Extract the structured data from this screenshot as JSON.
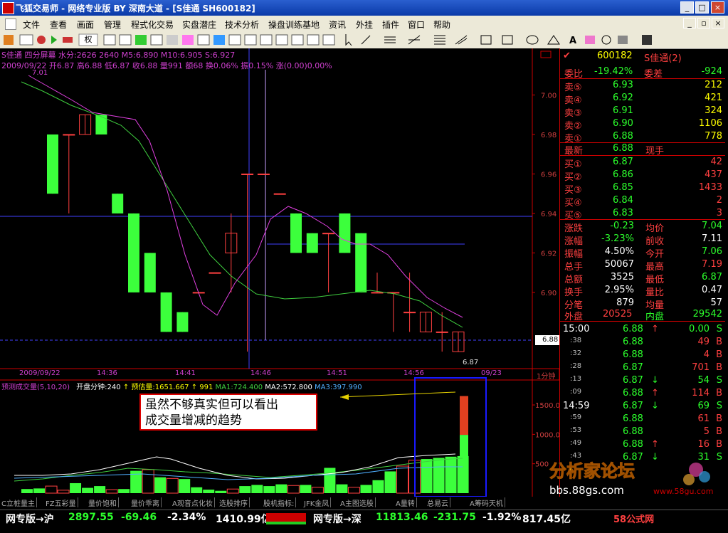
{
  "window": {
    "title": "飞狐交易师 - 网络专业版 BY 深南大道 - [S佳通 SH600182]",
    "btn_min": "_",
    "btn_max": "□",
    "btn_close": "×"
  },
  "menu": [
    "文件",
    "查看",
    "画面",
    "管理",
    "程式化交易",
    "实盘潜庄",
    "技术分析",
    "操盘训练基地",
    "资讯",
    "外挂",
    "插件",
    "窗口",
    "帮助"
  ],
  "toolbar": {
    "rights_label": "权"
  },
  "main_header": {
    "line1": "S佳通  四分屏幕  水分:2626  2640  M5:6.890  M10:6.905  S:6.927",
    "line2": "2009/09/22  开6.87  高6.88  低6.87  收6.88  量991  额68  换0.06%  振0.15%  涨(0.00)0.00%",
    "top_price_label": "7.01",
    "low_price_label": "6.87",
    "time_axis": [
      "2009/09/22",
      "14:36",
      "14:41",
      "14:46",
      "14:51",
      "14:56",
      "09/23"
    ],
    "period_label": "1分钟",
    "current_price_tag": "6.88"
  },
  "volume_header": {
    "left": "预测成交量(5,10,20)",
    "mid": "开盘分钟:240",
    "est": "预估量:1651.667",
    "v1": "991",
    "ma1": "MA1:724.400",
    "ma2": "MA2:572.800",
    "ma3": "MA3:397.990"
  },
  "annotation": {
    "line1": "虽然不够真实但可以看出",
    "line2": "成交量增减的趋势"
  },
  "chart_data": {
    "type": "candlestick",
    "y_ticks": [
      "7.00",
      "6.98",
      "6.96",
      "6.94",
      "6.92",
      "6.90"
    ],
    "ylim": [
      6.865,
      7.02
    ],
    "volume_ticks": [
      "1500.0",
      "1000.0",
      "500"
    ],
    "volume_ylim": [
      0,
      1900
    ],
    "candles": [
      {
        "o": 6.98,
        "c": 6.95,
        "h": 6.98,
        "l": 6.95
      },
      {
        "o": 6.98,
        "c": 6.98,
        "h": 6.98,
        "l": 6.94
      },
      {
        "o": 6.98,
        "c": 6.99,
        "h": 6.99,
        "l": 6.98
      },
      {
        "o": 6.99,
        "c": 6.98,
        "h": 6.99,
        "l": 6.98
      },
      {
        "o": 6.95,
        "c": 6.94,
        "h": 6.95,
        "l": 6.94
      },
      {
        "o": 6.94,
        "c": 6.9,
        "h": 6.94,
        "l": 6.9
      },
      {
        "o": 6.92,
        "c": 6.9,
        "h": 6.92,
        "l": 6.9
      },
      {
        "o": 6.9,
        "c": 6.88,
        "h": 6.9,
        "l": 6.88
      },
      {
        "o": 6.89,
        "c": 6.88,
        "h": 6.89,
        "l": 6.88
      },
      {
        "o": 6.9,
        "c": 6.9,
        "h": 6.9,
        "l": 6.9
      },
      {
        "o": 6.91,
        "c": 6.91,
        "h": 6.91,
        "l": 6.91
      },
      {
        "o": 6.92,
        "c": 6.93,
        "h": 6.94,
        "l": 6.9
      },
      {
        "o": 6.96,
        "c": 6.96,
        "h": 6.96,
        "l": 6.87
      },
      {
        "o": 6.96,
        "c": 6.96,
        "h": 6.96,
        "l": 6.96
      },
      {
        "o": 6.95,
        "c": 6.95,
        "h": 6.95,
        "l": 6.95
      },
      {
        "o": 6.94,
        "c": 6.92,
        "h": 6.94,
        "l": 6.92
      },
      {
        "o": 6.93,
        "c": 6.92,
        "h": 6.93,
        "l": 6.92
      },
      {
        "o": 6.93,
        "c": 6.93,
        "h": 6.93,
        "l": 6.9
      },
      {
        "o": 6.94,
        "c": 6.92,
        "h": 6.94,
        "l": 6.92
      },
      {
        "o": 6.93,
        "c": 6.9,
        "h": 6.93,
        "l": 6.9
      },
      {
        "o": 6.9,
        "c": 6.9,
        "h": 6.91,
        "l": 6.9
      },
      {
        "o": 6.9,
        "c": 6.9,
        "h": 6.9,
        "l": 6.88
      },
      {
        "o": 6.89,
        "c": 6.89,
        "h": 6.91,
        "l": 6.88
      },
      {
        "o": 6.88,
        "c": 6.89,
        "h": 6.89,
        "l": 6.88
      },
      {
        "o": 6.88,
        "c": 6.88,
        "h": 6.89,
        "l": 6.87
      },
      {
        "o": 6.87,
        "c": 6.88,
        "h": 6.88,
        "l": 6.87
      }
    ],
    "volumes": [
      70,
      80,
      120,
      50,
      170,
      90,
      120,
      60,
      70,
      380,
      400,
      270,
      250,
      240,
      100,
      60,
      40,
      70,
      120,
      140,
      120,
      150,
      130,
      140,
      100,
      430,
      150,
      100,
      140,
      220,
      370,
      460,
      560,
      580,
      600,
      620,
      630
    ],
    "est_volume": 1651.667,
    "current_volume": 991
  },
  "quote": {
    "code": "600182",
    "name": "S佳通(2)",
    "weibi_label": "委比",
    "weibi_value": "-19.42%",
    "weicha_label": "委差",
    "weicha_value": "-924",
    "sells": [
      {
        "label": "卖⑤",
        "price": "6.93",
        "vol": "212"
      },
      {
        "label": "卖④",
        "price": "6.92",
        "vol": "421"
      },
      {
        "label": "卖③",
        "price": "6.91",
        "vol": "324"
      },
      {
        "label": "卖②",
        "price": "6.90",
        "vol": "1106"
      },
      {
        "label": "卖①",
        "price": "6.88",
        "vol": "778"
      }
    ],
    "latest_label": "最新",
    "latest_value": "6.88",
    "latest_hand": "现手",
    "buys": [
      {
        "label": "买①",
        "price": "6.87",
        "vol": "42"
      },
      {
        "label": "买②",
        "price": "6.86",
        "vol": "437"
      },
      {
        "label": "买③",
        "price": "6.85",
        "vol": "1433"
      },
      {
        "label": "买④",
        "price": "6.84",
        "vol": "2"
      },
      {
        "label": "买⑤",
        "price": "6.83",
        "vol": "3"
      }
    ],
    "stats": [
      {
        "l1": "涨跌",
        "v1": "-0.23",
        "l2": "均价",
        "v2": "7.04"
      },
      {
        "l1": "涨幅",
        "v1": "-3.23%",
        "l2": "前收",
        "v2": "7.11"
      },
      {
        "l1": "振幅",
        "v1": "4.50%",
        "l2": "今开",
        "v2": "7.06"
      },
      {
        "l1": "总手",
        "v1": "50067",
        "l2": "最高",
        "v2": "7.19"
      },
      {
        "l1": "总额",
        "v1": "3525",
        "l2": "最低",
        "v2": "6.87"
      },
      {
        "l1": "换手",
        "v1": "2.95%",
        "l2": "量比",
        "v2": "0.47"
      },
      {
        "l1": "分笔",
        "v1": "879",
        "l2": "均量",
        "v2": "57"
      }
    ],
    "outer_label": "外盘",
    "outer_value": "20525",
    "inner_label": "内盘",
    "inner_value": "29542"
  },
  "ticks": [
    {
      "t": "15:00",
      "p": "6.88",
      "arrow": "↑",
      "v": "0.00",
      "s": "S"
    },
    {
      "t": ":38",
      "p": "6.88",
      "arrow": "",
      "v": "49",
      "s": "B"
    },
    {
      "t": ":32",
      "p": "6.88",
      "arrow": "",
      "v": "4",
      "s": "B"
    },
    {
      "t": ":28",
      "p": "6.87",
      "arrow": "",
      "v": "701",
      "s": "B"
    },
    {
      "t": ":13",
      "p": "6.87",
      "arrow": "↓",
      "v": "54",
      "s": "S"
    },
    {
      "t": ":09",
      "p": "6.88",
      "arrow": "↑",
      "v": "114",
      "s": "B"
    },
    {
      "t": "14:59",
      "p": "6.87",
      "arrow": "↓",
      "v": "69",
      "s": "S"
    },
    {
      "t": ":59",
      "p": "6.88",
      "arrow": "",
      "v": "61",
      "s": "B"
    },
    {
      "t": ":53",
      "p": "6.88",
      "arrow": "",
      "v": "5",
      "s": "B"
    },
    {
      "t": ":49",
      "p": "6.88",
      "arrow": "↑",
      "v": "16",
      "s": "B"
    },
    {
      "t": ":43",
      "p": "6.87",
      "arrow": "↓",
      "v": "31",
      "s": "S"
    }
  ],
  "tabs": [
    "C立桩量主",
    "FZ五彩量",
    "量价饱和",
    "量价乖离",
    "A观音点化妆",
    "选股排序",
    "股机指标:",
    "JFK金凤",
    "A主图选股",
    "A量转",
    "总易云",
    "A筹码天机"
  ],
  "status": {
    "sh_label": "网专版→沪",
    "sh_index": "2897.55",
    "sh_change": "-69.46",
    "sh_pct": "-2.34%",
    "sh_amount": "1410.99亿",
    "sz_label": "网专版→深",
    "sz_index": "11813.46",
    "sz_change": "-231.75",
    "sz_pct": "-1.92%",
    "sz_amount": "817.45亿"
  },
  "watermark": {
    "forum": "分析家论坛",
    "site1": "bbs.88gs.com",
    "site2": "58公式网",
    "site3": "www.58gu.com"
  }
}
